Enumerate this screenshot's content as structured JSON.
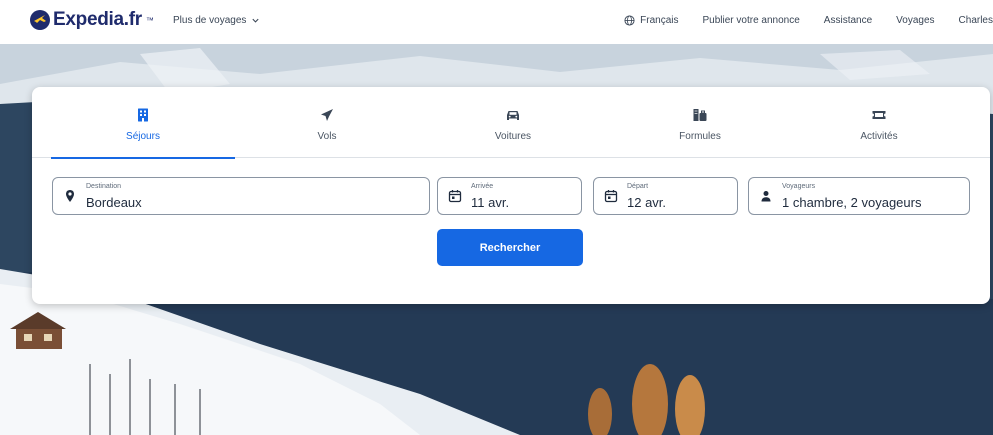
{
  "header": {
    "logo_text": "Expedia.fr",
    "logo_tm": "™",
    "more_trips": "Plus de voyages",
    "nav": {
      "language": "Français",
      "list_property": "Publier votre annonce",
      "support": "Assistance",
      "trips": "Voyages",
      "user": "Charles"
    }
  },
  "tabs": [
    {
      "label": "Séjours",
      "icon": "hotel-icon",
      "active": true
    },
    {
      "label": "Vols",
      "icon": "plane-icon",
      "active": false
    },
    {
      "label": "Voitures",
      "icon": "car-icon",
      "active": false
    },
    {
      "label": "Formules",
      "icon": "package-icon",
      "active": false
    },
    {
      "label": "Activités",
      "icon": "ticket-icon",
      "active": false
    }
  ],
  "search": {
    "destination": {
      "label": "Destination",
      "value": "Bordeaux"
    },
    "checkin": {
      "label": "Arrivée",
      "value": "11 avr."
    },
    "checkout": {
      "label": "Départ",
      "value": "12 avr."
    },
    "travelers": {
      "label": "Voyageurs",
      "value": "1 chambre, 2 voyageurs"
    },
    "submit_label": "Rechercher"
  },
  "colors": {
    "accent": "#1668e3",
    "brand_navy": "#1f2b6c",
    "brand_yellow": "#ffc72c"
  }
}
